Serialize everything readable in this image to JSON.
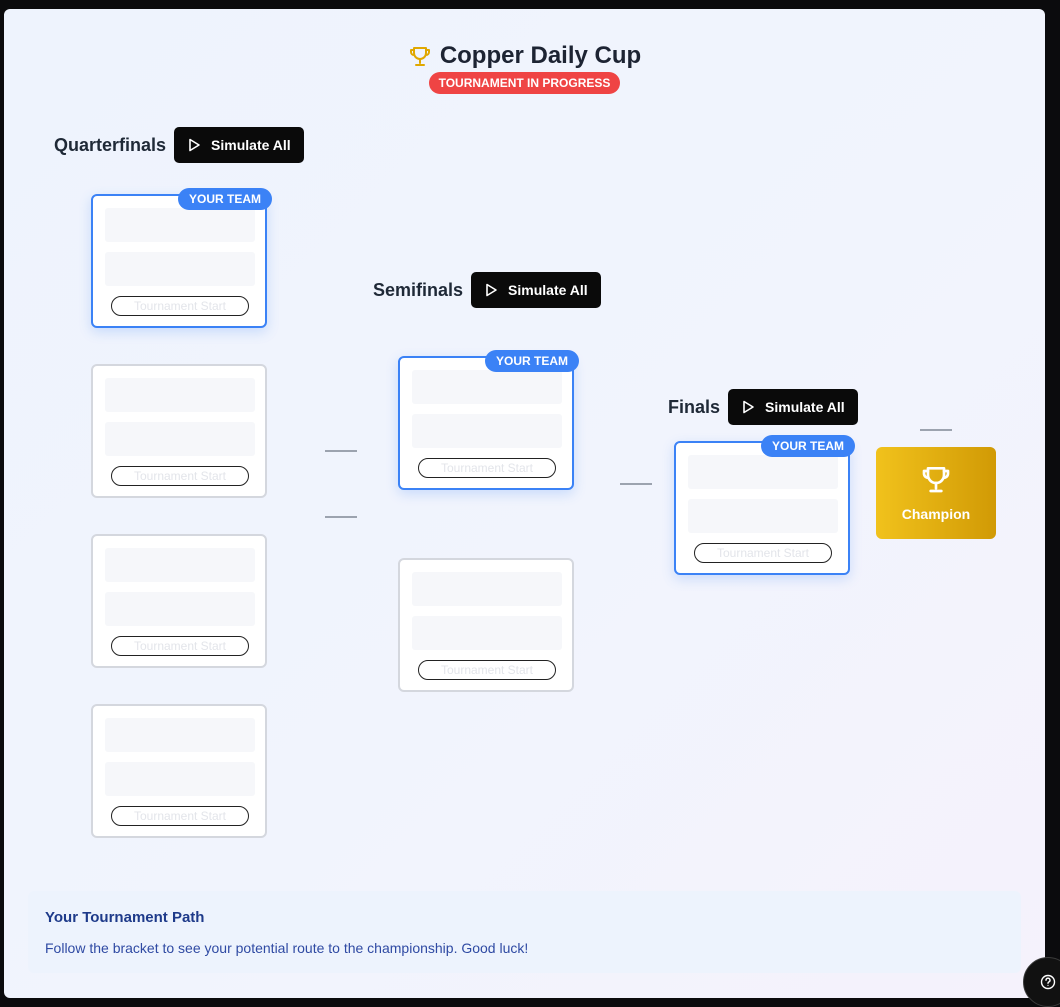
{
  "header": {
    "title": "Copper Daily Cup",
    "status": "TOURNAMENT IN PROGRESS",
    "trophy_color": "#e0a800"
  },
  "simulate_label": "Simulate All",
  "your_team_label": "YOUR TEAM",
  "rounds": [
    {
      "title": "Quarterfinals"
    },
    {
      "title": "Semifinals"
    },
    {
      "title": "Finals"
    }
  ],
  "matches": {
    "qf1": {
      "status": "Tournament Start"
    },
    "qf2": {
      "status": "Tournament Start"
    },
    "qf3": {
      "status": "Tournament Start"
    },
    "qf4": {
      "status": "Tournament Start"
    },
    "sf1": {
      "status": "Tournament Start"
    },
    "sf2": {
      "status": "Tournament Start"
    },
    "final": {
      "status": "Tournament Start"
    }
  },
  "champion": {
    "label": "Champion"
  },
  "path_info": {
    "title": "Your Tournament Path",
    "text": "Follow the bracket to see your potential route to the championship. Good luck!"
  },
  "colors": {
    "accent": "#3b82f6",
    "status_red": "#ef4444",
    "champion_gold": "#e0b010"
  }
}
